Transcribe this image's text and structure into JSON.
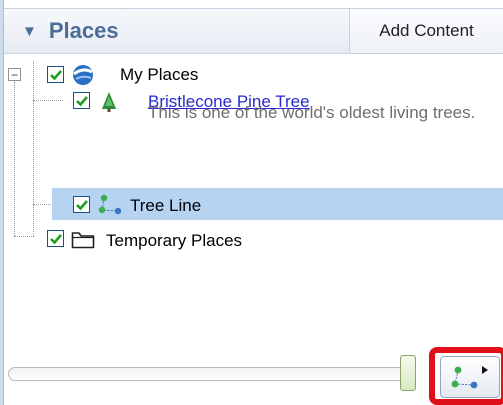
{
  "header": {
    "title": "Places",
    "add_content_label": "Add Content"
  },
  "tree": {
    "my_places": {
      "label": "My Places",
      "checked": true,
      "expanded": true,
      "icon": "globe-icon"
    },
    "bristlecone": {
      "label": "Bristlecone Pine Tree",
      "checked": true,
      "icon": "tree-placemark-icon",
      "description": "This is one of the world's oldest living trees."
    },
    "tree_line": {
      "label": "Tree Line",
      "checked": true,
      "selected": true,
      "icon": "path-icon"
    },
    "temporary_places": {
      "label": "Temporary Places",
      "checked": true,
      "icon": "folder-icon"
    }
  },
  "bottom": {
    "slider_level": 1.0,
    "tour_button_icon": "play-tour-icon",
    "highlight_color": "#e0101a"
  },
  "colors": {
    "accent": "#4d6d99",
    "selection": "#b7d3f2",
    "checkmark": "#1f9e1f",
    "link": "#2a2ad0"
  }
}
